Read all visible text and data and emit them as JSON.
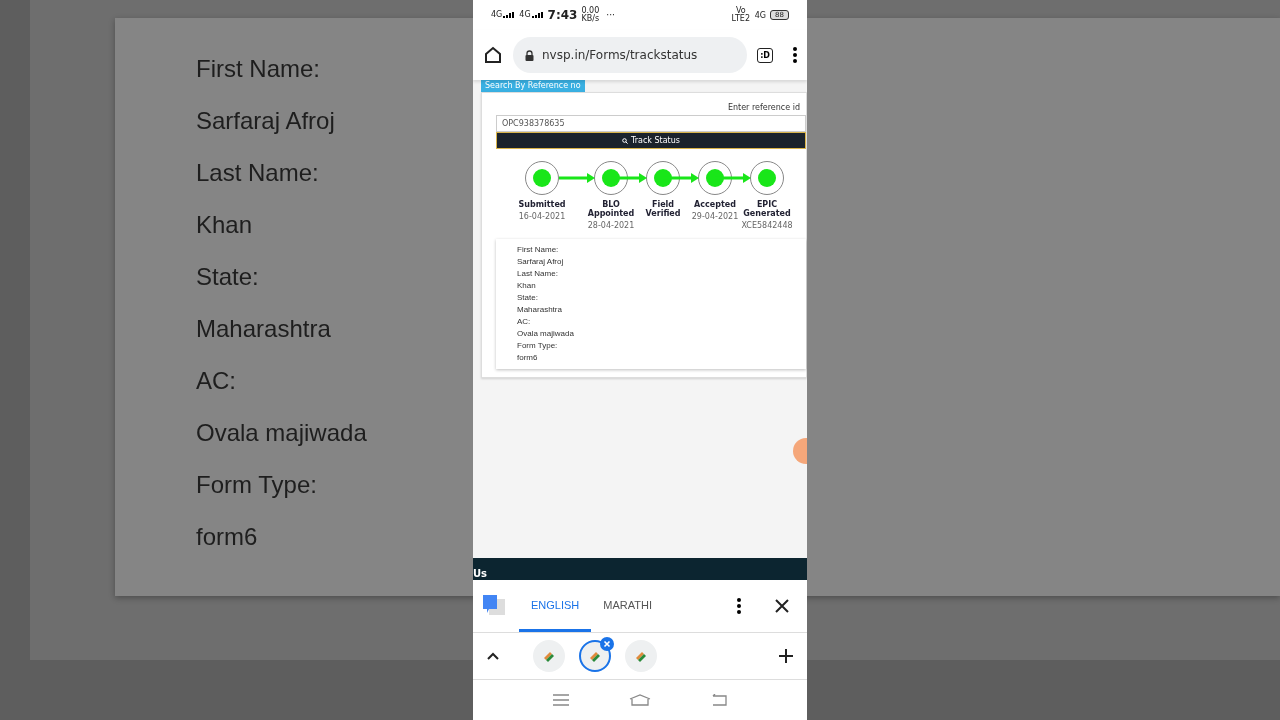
{
  "backdrop": {
    "fields": [
      {
        "label": "First Name:",
        "value": "Sarfaraj Afroj"
      },
      {
        "label": "Last Name:",
        "value": "Khan"
      },
      {
        "label": "State:",
        "value": "Maharashtra"
      },
      {
        "label": "AC:",
        "value": "Ovala majiwada"
      },
      {
        "label": "Form Type:",
        "value": "form6"
      }
    ]
  },
  "status_bar": {
    "time": "7:43",
    "net_speed": "0.00",
    "net_unit": "KB/s",
    "more": "···",
    "volte": "Vo LTE2",
    "network": "4G",
    "battery": "88",
    "sim_labels": [
      "4G",
      "4G"
    ]
  },
  "browser": {
    "url": "nvsp.in/Forms/trackstatus",
    "tab_count": ":D"
  },
  "page": {
    "tab_label": "Search By Reference no",
    "input_label": "Enter reference id",
    "reference": "OPC938378635",
    "button": "Track Status",
    "steps": [
      {
        "label": "Submitted",
        "date": "16-04-2021",
        "completed": true
      },
      {
        "label": "BLO Appointed",
        "date": "28-04-2021",
        "completed": true
      },
      {
        "label": "Field Verified",
        "completed": true
      },
      {
        "label": "Accepted",
        "date": "29-04-2021",
        "completed": true
      },
      {
        "label": "EPIC Generated",
        "date": "XCE5842448",
        "completed": true
      }
    ],
    "fields": [
      {
        "label": "First Name:",
        "value": "Sarfaraj Afroj"
      },
      {
        "label": "Last Name:",
        "value": "Khan"
      },
      {
        "label": "State:",
        "value": "Maharashtra"
      },
      {
        "label": "AC:",
        "value": "Ovala majiwada"
      },
      {
        "label": "Form Type:",
        "value": "form6"
      }
    ],
    "footer_text": "Us"
  },
  "translate_bar": {
    "languages": [
      {
        "label": "ENGLISH",
        "selected": true
      },
      {
        "label": "MARATHI",
        "selected": false
      }
    ]
  },
  "tabs": [
    {
      "selected": false
    },
    {
      "selected": true
    },
    {
      "selected": false
    }
  ]
}
